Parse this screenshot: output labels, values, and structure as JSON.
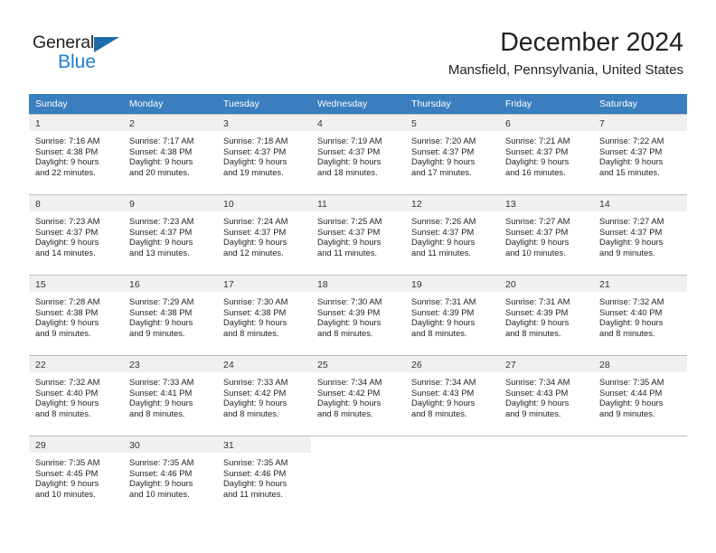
{
  "brand": {
    "name_dark": "General",
    "name_light": "Blue",
    "accent_color": "#1b7fd4",
    "triangle_color": "#1b6ca8"
  },
  "header": {
    "title": "December 2024",
    "subtitle": "Mansfield, Pennsylvania, United States"
  },
  "calendar": {
    "header_background": "#3a7ebf",
    "daynum_background": "#f0f0f0",
    "weekday_headers": [
      "Sunday",
      "Monday",
      "Tuesday",
      "Wednesday",
      "Thursday",
      "Friday",
      "Saturday"
    ],
    "weeks": [
      [
        {
          "day": "1",
          "sunrise": "Sunrise: 7:16 AM",
          "sunset": "Sunset: 4:38 PM",
          "daylight_line1": "Daylight: 9 hours",
          "daylight_line2": "and 22 minutes."
        },
        {
          "day": "2",
          "sunrise": "Sunrise: 7:17 AM",
          "sunset": "Sunset: 4:38 PM",
          "daylight_line1": "Daylight: 9 hours",
          "daylight_line2": "and 20 minutes."
        },
        {
          "day": "3",
          "sunrise": "Sunrise: 7:18 AM",
          "sunset": "Sunset: 4:37 PM",
          "daylight_line1": "Daylight: 9 hours",
          "daylight_line2": "and 19 minutes."
        },
        {
          "day": "4",
          "sunrise": "Sunrise: 7:19 AM",
          "sunset": "Sunset: 4:37 PM",
          "daylight_line1": "Daylight: 9 hours",
          "daylight_line2": "and 18 minutes."
        },
        {
          "day": "5",
          "sunrise": "Sunrise: 7:20 AM",
          "sunset": "Sunset: 4:37 PM",
          "daylight_line1": "Daylight: 9 hours",
          "daylight_line2": "and 17 minutes."
        },
        {
          "day": "6",
          "sunrise": "Sunrise: 7:21 AM",
          "sunset": "Sunset: 4:37 PM",
          "daylight_line1": "Daylight: 9 hours",
          "daylight_line2": "and 16 minutes."
        },
        {
          "day": "7",
          "sunrise": "Sunrise: 7:22 AM",
          "sunset": "Sunset: 4:37 PM",
          "daylight_line1": "Daylight: 9 hours",
          "daylight_line2": "and 15 minutes."
        }
      ],
      [
        {
          "day": "8",
          "sunrise": "Sunrise: 7:23 AM",
          "sunset": "Sunset: 4:37 PM",
          "daylight_line1": "Daylight: 9 hours",
          "daylight_line2": "and 14 minutes."
        },
        {
          "day": "9",
          "sunrise": "Sunrise: 7:23 AM",
          "sunset": "Sunset: 4:37 PM",
          "daylight_line1": "Daylight: 9 hours",
          "daylight_line2": "and 13 minutes."
        },
        {
          "day": "10",
          "sunrise": "Sunrise: 7:24 AM",
          "sunset": "Sunset: 4:37 PM",
          "daylight_line1": "Daylight: 9 hours",
          "daylight_line2": "and 12 minutes."
        },
        {
          "day": "11",
          "sunrise": "Sunrise: 7:25 AM",
          "sunset": "Sunset: 4:37 PM",
          "daylight_line1": "Daylight: 9 hours",
          "daylight_line2": "and 11 minutes."
        },
        {
          "day": "12",
          "sunrise": "Sunrise: 7:26 AM",
          "sunset": "Sunset: 4:37 PM",
          "daylight_line1": "Daylight: 9 hours",
          "daylight_line2": "and 11 minutes."
        },
        {
          "day": "13",
          "sunrise": "Sunrise: 7:27 AM",
          "sunset": "Sunset: 4:37 PM",
          "daylight_line1": "Daylight: 9 hours",
          "daylight_line2": "and 10 minutes."
        },
        {
          "day": "14",
          "sunrise": "Sunrise: 7:27 AM",
          "sunset": "Sunset: 4:37 PM",
          "daylight_line1": "Daylight: 9 hours",
          "daylight_line2": "and 9 minutes."
        }
      ],
      [
        {
          "day": "15",
          "sunrise": "Sunrise: 7:28 AM",
          "sunset": "Sunset: 4:38 PM",
          "daylight_line1": "Daylight: 9 hours",
          "daylight_line2": "and 9 minutes."
        },
        {
          "day": "16",
          "sunrise": "Sunrise: 7:29 AM",
          "sunset": "Sunset: 4:38 PM",
          "daylight_line1": "Daylight: 9 hours",
          "daylight_line2": "and 9 minutes."
        },
        {
          "day": "17",
          "sunrise": "Sunrise: 7:30 AM",
          "sunset": "Sunset: 4:38 PM",
          "daylight_line1": "Daylight: 9 hours",
          "daylight_line2": "and 8 minutes."
        },
        {
          "day": "18",
          "sunrise": "Sunrise: 7:30 AM",
          "sunset": "Sunset: 4:39 PM",
          "daylight_line1": "Daylight: 9 hours",
          "daylight_line2": "and 8 minutes."
        },
        {
          "day": "19",
          "sunrise": "Sunrise: 7:31 AM",
          "sunset": "Sunset: 4:39 PM",
          "daylight_line1": "Daylight: 9 hours",
          "daylight_line2": "and 8 minutes."
        },
        {
          "day": "20",
          "sunrise": "Sunrise: 7:31 AM",
          "sunset": "Sunset: 4:39 PM",
          "daylight_line1": "Daylight: 9 hours",
          "daylight_line2": "and 8 minutes."
        },
        {
          "day": "21",
          "sunrise": "Sunrise: 7:32 AM",
          "sunset": "Sunset: 4:40 PM",
          "daylight_line1": "Daylight: 9 hours",
          "daylight_line2": "and 8 minutes."
        }
      ],
      [
        {
          "day": "22",
          "sunrise": "Sunrise: 7:32 AM",
          "sunset": "Sunset: 4:40 PM",
          "daylight_line1": "Daylight: 9 hours",
          "daylight_line2": "and 8 minutes."
        },
        {
          "day": "23",
          "sunrise": "Sunrise: 7:33 AM",
          "sunset": "Sunset: 4:41 PM",
          "daylight_line1": "Daylight: 9 hours",
          "daylight_line2": "and 8 minutes."
        },
        {
          "day": "24",
          "sunrise": "Sunrise: 7:33 AM",
          "sunset": "Sunset: 4:42 PM",
          "daylight_line1": "Daylight: 9 hours",
          "daylight_line2": "and 8 minutes."
        },
        {
          "day": "25",
          "sunrise": "Sunrise: 7:34 AM",
          "sunset": "Sunset: 4:42 PM",
          "daylight_line1": "Daylight: 9 hours",
          "daylight_line2": "and 8 minutes."
        },
        {
          "day": "26",
          "sunrise": "Sunrise: 7:34 AM",
          "sunset": "Sunset: 4:43 PM",
          "daylight_line1": "Daylight: 9 hours",
          "daylight_line2": "and 8 minutes."
        },
        {
          "day": "27",
          "sunrise": "Sunrise: 7:34 AM",
          "sunset": "Sunset: 4:43 PM",
          "daylight_line1": "Daylight: 9 hours",
          "daylight_line2": "and 9 minutes."
        },
        {
          "day": "28",
          "sunrise": "Sunrise: 7:35 AM",
          "sunset": "Sunset: 4:44 PM",
          "daylight_line1": "Daylight: 9 hours",
          "daylight_line2": "and 9 minutes."
        }
      ],
      [
        {
          "day": "29",
          "sunrise": "Sunrise: 7:35 AM",
          "sunset": "Sunset: 4:45 PM",
          "daylight_line1": "Daylight: 9 hours",
          "daylight_line2": "and 10 minutes."
        },
        {
          "day": "30",
          "sunrise": "Sunrise: 7:35 AM",
          "sunset": "Sunset: 4:46 PM",
          "daylight_line1": "Daylight: 9 hours",
          "daylight_line2": "and 10 minutes."
        },
        {
          "day": "31",
          "sunrise": "Sunrise: 7:35 AM",
          "sunset": "Sunset: 4:46 PM",
          "daylight_line1": "Daylight: 9 hours",
          "daylight_line2": "and 11 minutes."
        },
        {
          "day": "",
          "sunrise": "",
          "sunset": "",
          "daylight_line1": "",
          "daylight_line2": ""
        },
        {
          "day": "",
          "sunrise": "",
          "sunset": "",
          "daylight_line1": "",
          "daylight_line2": ""
        },
        {
          "day": "",
          "sunrise": "",
          "sunset": "",
          "daylight_line1": "",
          "daylight_line2": ""
        },
        {
          "day": "",
          "sunrise": "",
          "sunset": "",
          "daylight_line1": "",
          "daylight_line2": ""
        }
      ]
    ]
  }
}
